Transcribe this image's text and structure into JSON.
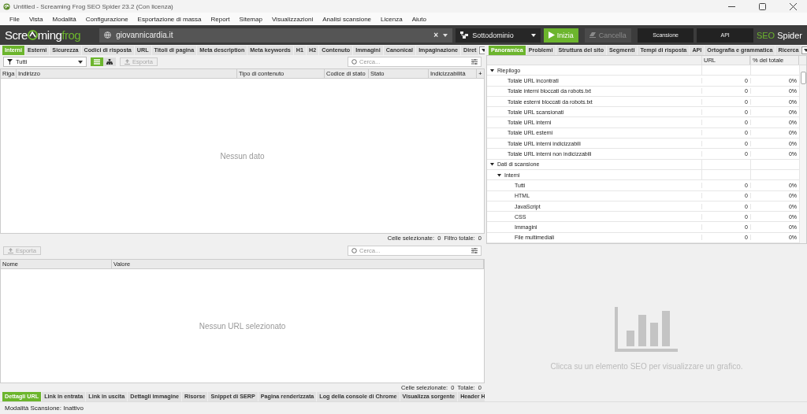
{
  "window": {
    "title": "Untitled - Screaming Frog SEO Spider 23.2 (Con licenza)"
  },
  "menu": [
    "File",
    "Vista",
    "Modalità",
    "Configurazione",
    "Esportazione di massa",
    "Report",
    "Sitemap",
    "Visualizzazioni",
    "Analisi scansione",
    "Licenza",
    "Aiuto"
  ],
  "toolbar": {
    "logo": {
      "before": "Scre",
      "middle": "ming",
      "accent": "frog"
    },
    "url_field": {
      "value": "giovannicardia.it"
    },
    "clear": "×",
    "mode": "Sottodominio",
    "start": {
      "label": "Inizia",
      "disabled": false
    },
    "clear_button": {
      "label": "Cancella",
      "disabled": true
    },
    "dark_buttons": [
      "Scansione",
      "API"
    ],
    "product": {
      "accent": "SEO",
      "rest": "Spider"
    }
  },
  "left_tabs": [
    {
      "label": "Interni",
      "selected": true
    },
    {
      "label": "Esterni",
      "selected": false
    },
    {
      "label": "Sicurezza",
      "selected": false
    },
    {
      "label": "Codici di risposta",
      "selected": false
    },
    {
      "label": "URL",
      "selected": false
    },
    {
      "label": "Titoli di pagina",
      "selected": false
    },
    {
      "label": "Meta description",
      "selected": false
    },
    {
      "label": "Meta keywords",
      "selected": false
    },
    {
      "label": "H1",
      "selected": false
    },
    {
      "label": "H2",
      "selected": false
    },
    {
      "label": "Contenuto",
      "selected": false
    },
    {
      "label": "Immagini",
      "selected": false
    },
    {
      "label": "Canonical",
      "selected": false
    },
    {
      "label": "Impaginazione",
      "selected": false
    },
    {
      "label": "Diret",
      "selected": false
    }
  ],
  "filter": {
    "value": "Tutti",
    "views": [
      {
        "kind": "list",
        "selected": true
      },
      {
        "kind": "tree",
        "selected": false
      }
    ],
    "export": "Esporta",
    "search_placeholder": "Cerca..."
  },
  "main_table": {
    "columns": [
      "Riga",
      "Indirizzo",
      "Tipo di contenuto",
      "Codice di stato",
      "Stato",
      "Indicizzabilità"
    ],
    "add": "+",
    "empty": "Nessun dato",
    "status": "Celle selezionate:  0  Filtro totale:  0"
  },
  "detail": {
    "export": "Esporta",
    "search_placeholder": "Cerca...",
    "columns": [
      "Nome",
      "Valore"
    ],
    "empty": "Nessun URL selezionato",
    "status": "Celle selezionate:  0  Totale:  0"
  },
  "bottom_tabs": [
    {
      "label": "Dettagli URL",
      "selected": true
    },
    {
      "label": "Link in entrata",
      "selected": false
    },
    {
      "label": "Link in uscita",
      "selected": false
    },
    {
      "label": "Dettagli immagine",
      "selected": false
    },
    {
      "label": "Risorse",
      "selected": false
    },
    {
      "label": "Snippet di SERP",
      "selected": false
    },
    {
      "label": "Pagina renderizzata",
      "selected": false
    },
    {
      "label": "Log della console di Chrome",
      "selected": false
    },
    {
      "label": "Visualizza sorgente",
      "selected": false
    },
    {
      "label": "Header H",
      "selected": false
    }
  ],
  "right_tabs": [
    {
      "label": "Panoramica",
      "selected": true
    },
    {
      "label": "Problemi",
      "selected": false
    },
    {
      "label": "Struttura del sito",
      "selected": false
    },
    {
      "label": "Segmenti",
      "selected": false
    },
    {
      "label": "Tempi di risposta",
      "selected": false
    },
    {
      "label": "API",
      "selected": false
    },
    {
      "label": "Ortografia e grammatica",
      "selected": false
    },
    {
      "label": "Ricerca",
      "selected": false
    }
  ],
  "overview": {
    "columns": [
      "URL",
      "% del totale"
    ],
    "tree": [
      {
        "label": "Riepilogo",
        "expanded": true,
        "children": [
          {
            "label": "Totale URL incontrati",
            "url": "0",
            "percent": "0%"
          },
          {
            "label": "Totale interni bloccati da robots.txt",
            "url": "0",
            "percent": "0%"
          },
          {
            "label": "Totale esterni bloccati da robots.txt",
            "url": "0",
            "percent": "0%"
          },
          {
            "label": "Totale URL scansionati",
            "url": "0",
            "percent": "0%"
          },
          {
            "label": "Totale URL interni",
            "url": "0",
            "percent": "0%"
          },
          {
            "label": "Totale URL esterni",
            "url": "0",
            "percent": "0%"
          },
          {
            "label": "Totale URL interni indicizzabili",
            "url": "0",
            "percent": "0%"
          },
          {
            "label": "Totale URL interni non indicizzabili",
            "url": "0",
            "percent": "0%"
          }
        ]
      },
      {
        "label": "Dati di scansione",
        "expanded": true,
        "children": [
          {
            "label": "Interni",
            "expanded": true,
            "children": [
              {
                "label": "Tutti",
                "url": "0",
                "percent": "0%"
              },
              {
                "label": "HTML",
                "url": "0",
                "percent": "0%"
              },
              {
                "label": "JavaScript",
                "url": "0",
                "percent": "0%"
              },
              {
                "label": "CSS",
                "url": "0",
                "percent": "0%"
              },
              {
                "label": "Immagini",
                "url": "0",
                "percent": "0%"
              },
              {
                "label": "File multimediali",
                "url": "0",
                "percent": "0%"
              }
            ]
          }
        ]
      }
    ]
  },
  "chart_hint": "Clicca su un elemento SEO per visualizzare un grafico.",
  "status_bar": "Modalità Scansione: Inattivo"
}
